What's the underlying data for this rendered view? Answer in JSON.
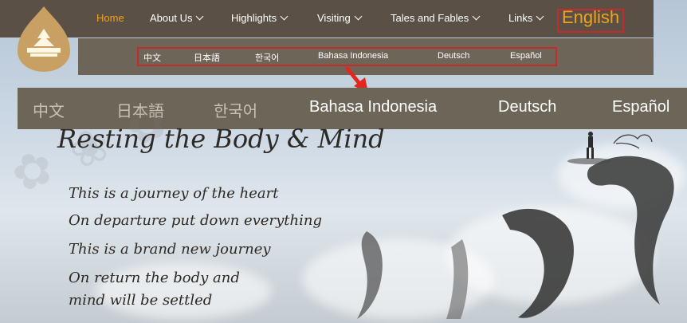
{
  "nav": {
    "items": [
      {
        "label": "Home",
        "active": true,
        "dropdown": false
      },
      {
        "label": "About Us",
        "active": false,
        "dropdown": true
      },
      {
        "label": "Highlights",
        "active": false,
        "dropdown": true
      },
      {
        "label": "Visiting",
        "active": false,
        "dropdown": true
      },
      {
        "label": "Tales and Fables",
        "active": false,
        "dropdown": true
      },
      {
        "label": "Links",
        "active": false,
        "dropdown": true
      }
    ],
    "language_current": "English"
  },
  "language_menu": [
    "中文",
    "日本語",
    "한국어",
    "Bahasa Indonesia",
    "Deutsch",
    "Español"
  ],
  "content": {
    "heading": "Resting the Body & Mind",
    "poem": [
      "This is a journey of the heart",
      "On departure put down everything",
      "This is a brand new journey",
      "On return the body and",
      "mind will be settled"
    ]
  },
  "colors": {
    "nav_bg": "#5a5045",
    "accent": "#f0a21e",
    "highlight_border": "#c62a2a",
    "lang_bar_bg": "#6e6559"
  }
}
